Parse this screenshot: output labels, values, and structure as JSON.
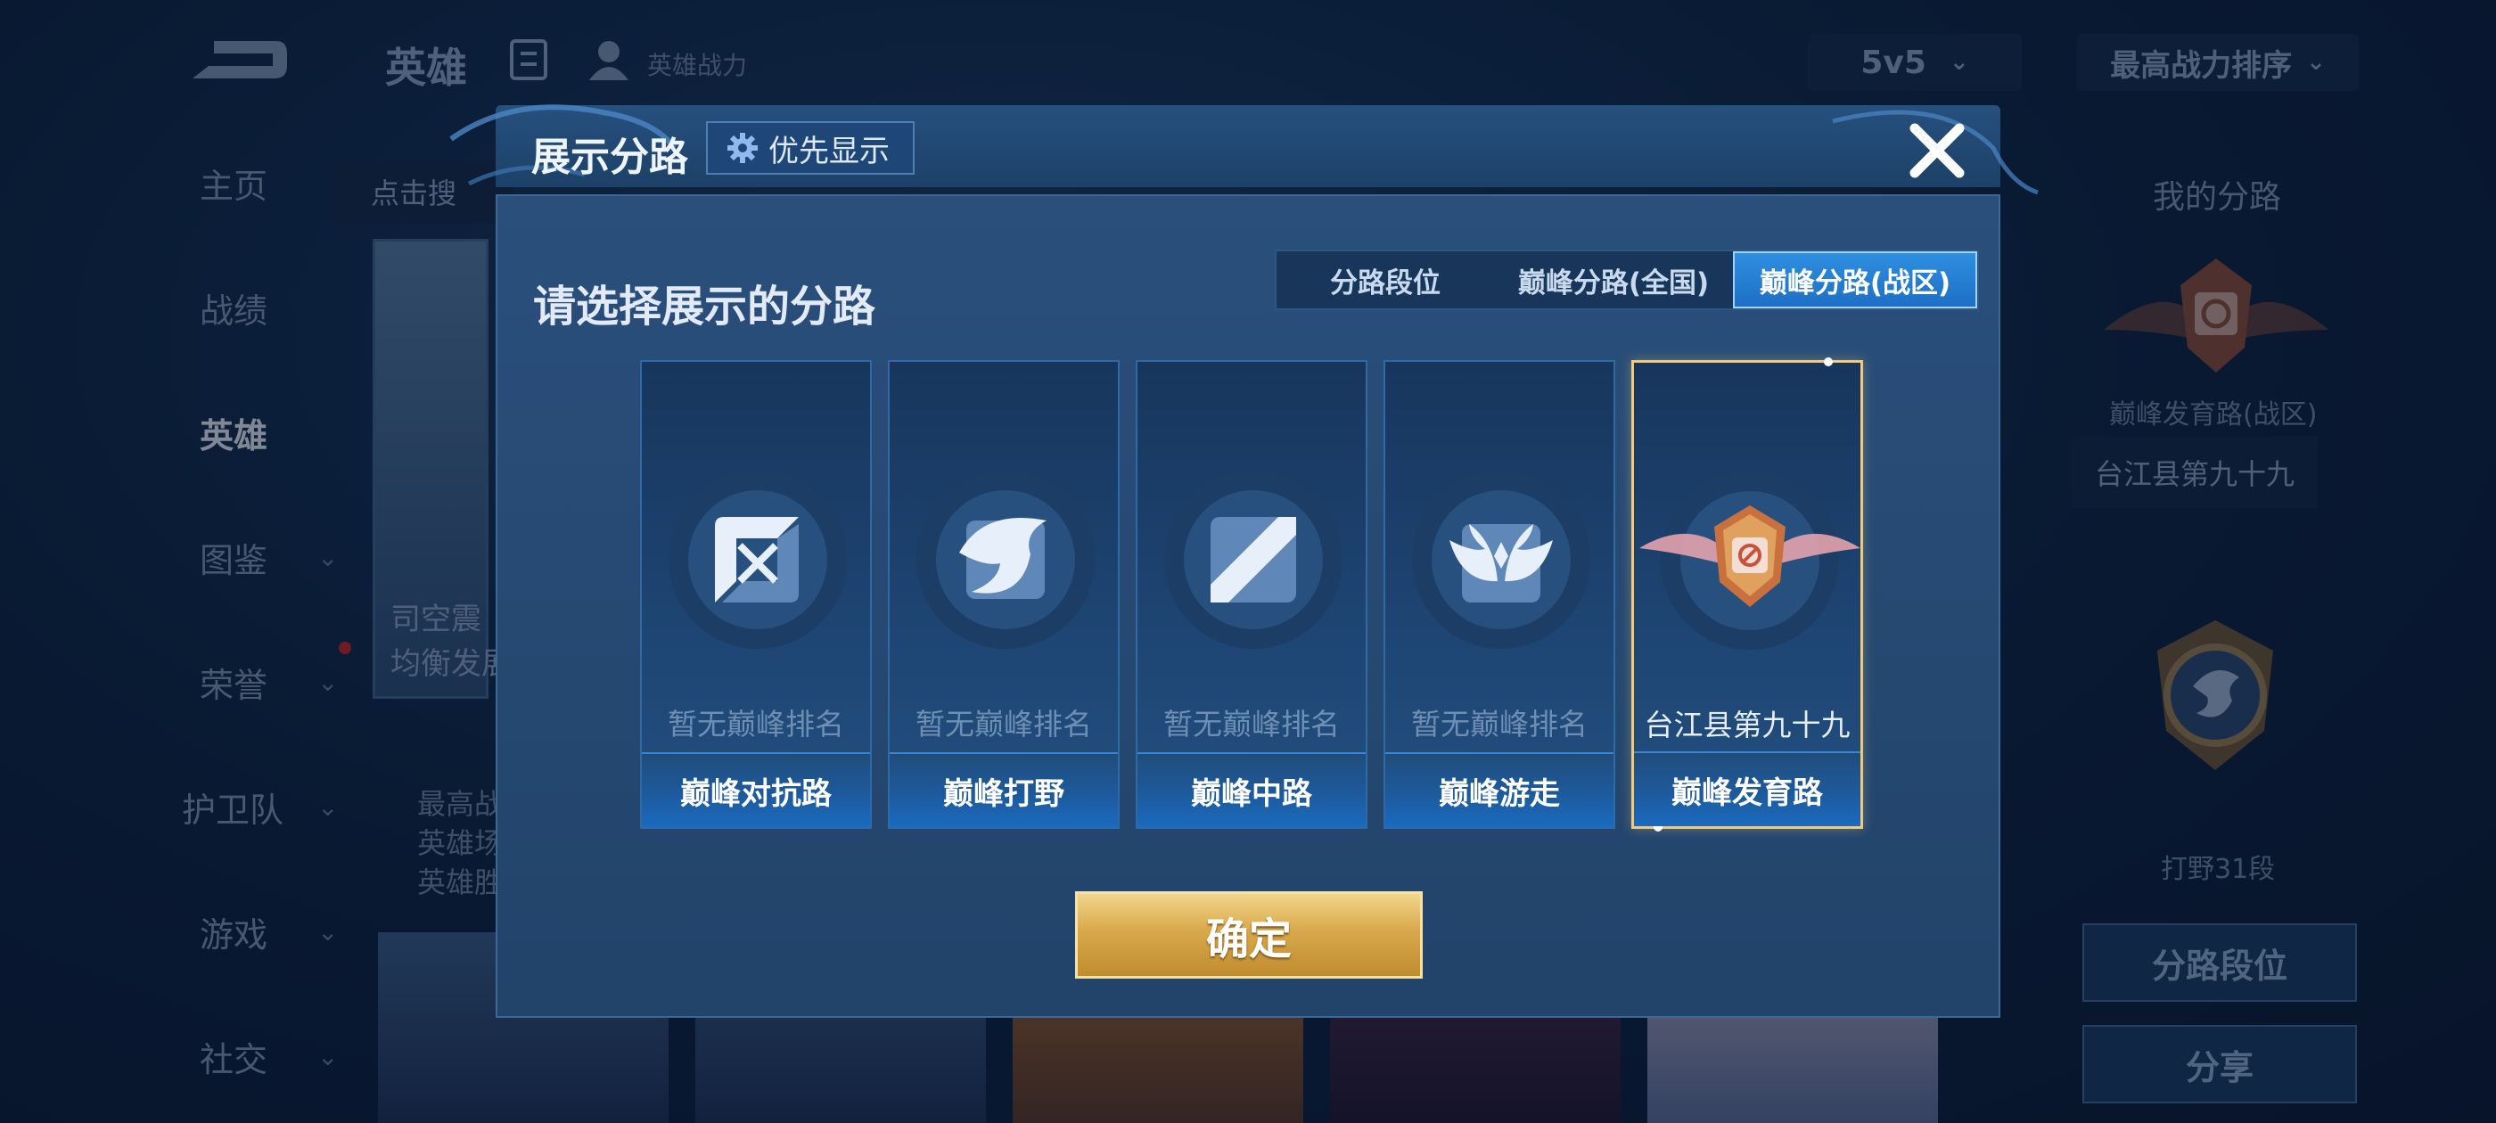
{
  "background": {
    "page_title": "英雄",
    "power_label": "英雄战力",
    "mode_select": "5v5",
    "sort_select": "最高战力排序",
    "search_placeholder": "点击搜",
    "side_nav": [
      "主页",
      "战绩",
      "英雄",
      "图鉴",
      "荣誉",
      "护卫队",
      "游戏",
      "社交"
    ],
    "hero_card_text": [
      "司空震",
      "均衡发展"
    ],
    "hero_stats": [
      "最高战",
      "英雄场",
      "英雄胜"
    ],
    "right_panel": {
      "title": "我的分路",
      "badge_label": "巅峰发育路(战区)",
      "rank_box": "台江县第九十九",
      "jungle_rank": "打野31段",
      "button_lane_rank": "分路段位",
      "button_share": "分享"
    }
  },
  "modal": {
    "title": "展示分路",
    "priority_label": "优先显示",
    "prompt": "请选择展示的分路",
    "tabs": [
      {
        "label": "分路段位",
        "active": false
      },
      {
        "label": "巅峰分路(全国)",
        "active": false
      },
      {
        "label": "巅峰分路(战区)",
        "active": true
      }
    ],
    "cards": [
      {
        "lane": "巅峰对抗路",
        "rank": "暂无巅峰排名",
        "icon": "clash-lane-sword-icon",
        "selected": false
      },
      {
        "lane": "巅峰打野",
        "rank": "暂无巅峰排名",
        "icon": "jungle-dragon-icon",
        "selected": false
      },
      {
        "lane": "巅峰中路",
        "rank": "暂无巅峰排名",
        "icon": "mid-lane-slash-icon",
        "selected": false
      },
      {
        "lane": "巅峰游走",
        "rank": "暂无巅峰排名",
        "icon": "roam-wings-icon",
        "selected": false
      },
      {
        "lane": "巅峰发育路",
        "rank": "台江县第九十九",
        "icon": "farm-lane-badge-icon",
        "selected": true
      }
    ],
    "confirm_label": "确定"
  },
  "colors": {
    "accent_blue": "#1d6fc4",
    "gold": "#d8a94c",
    "selected_border": "#f0c97a"
  }
}
